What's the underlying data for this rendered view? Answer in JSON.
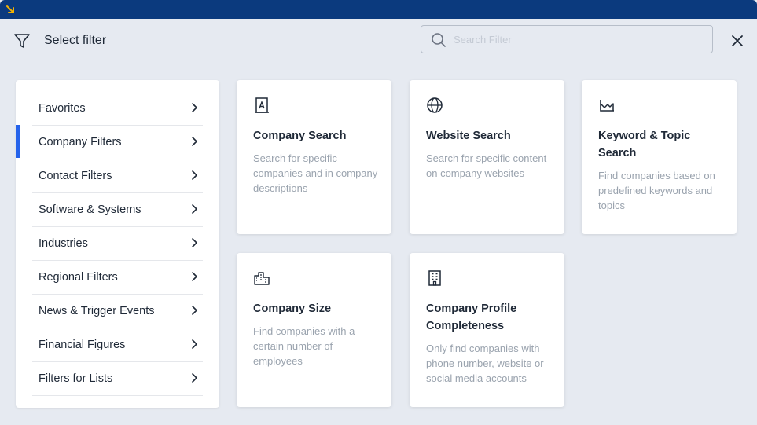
{
  "header": {
    "title": "Select filter",
    "search_placeholder": "Search Filter",
    "search_value": ""
  },
  "sidebar": {
    "items": [
      {
        "label": "Favorites",
        "active": false
      },
      {
        "label": "Company Filters",
        "active": true
      },
      {
        "label": "Contact Filters",
        "active": false
      },
      {
        "label": "Software & Systems",
        "active": false
      },
      {
        "label": "Industries",
        "active": false
      },
      {
        "label": "Regional Filters",
        "active": false
      },
      {
        "label": "News & Trigger Events",
        "active": false
      },
      {
        "label": "Financial Figures",
        "active": false
      },
      {
        "label": "Filters for Lists",
        "active": false
      }
    ]
  },
  "cards": [
    {
      "icon": "company-building-icon",
      "title": "Company Search",
      "description": "Search for specific companies and in company descriptions"
    },
    {
      "icon": "globe-icon",
      "title": "Website Search",
      "description": "Search for specific content on company websites"
    },
    {
      "icon": "chart-icon",
      "title": "Keyword & Topic Search",
      "description": "Find companies based on predefined keywords and topics"
    },
    {
      "icon": "city-buildings-icon",
      "title": "Company Size",
      "description": "Find companies with a certain number of employees"
    },
    {
      "icon": "office-building-icon",
      "title": "Company Profile Completeness",
      "description": "Only find companies with phone number, website or social media accounts"
    }
  ],
  "colors": {
    "topbar": "#0b3a7e",
    "accent": "#2563eb",
    "background": "#e6eaf1",
    "corner_arrow": "#f5b301"
  }
}
